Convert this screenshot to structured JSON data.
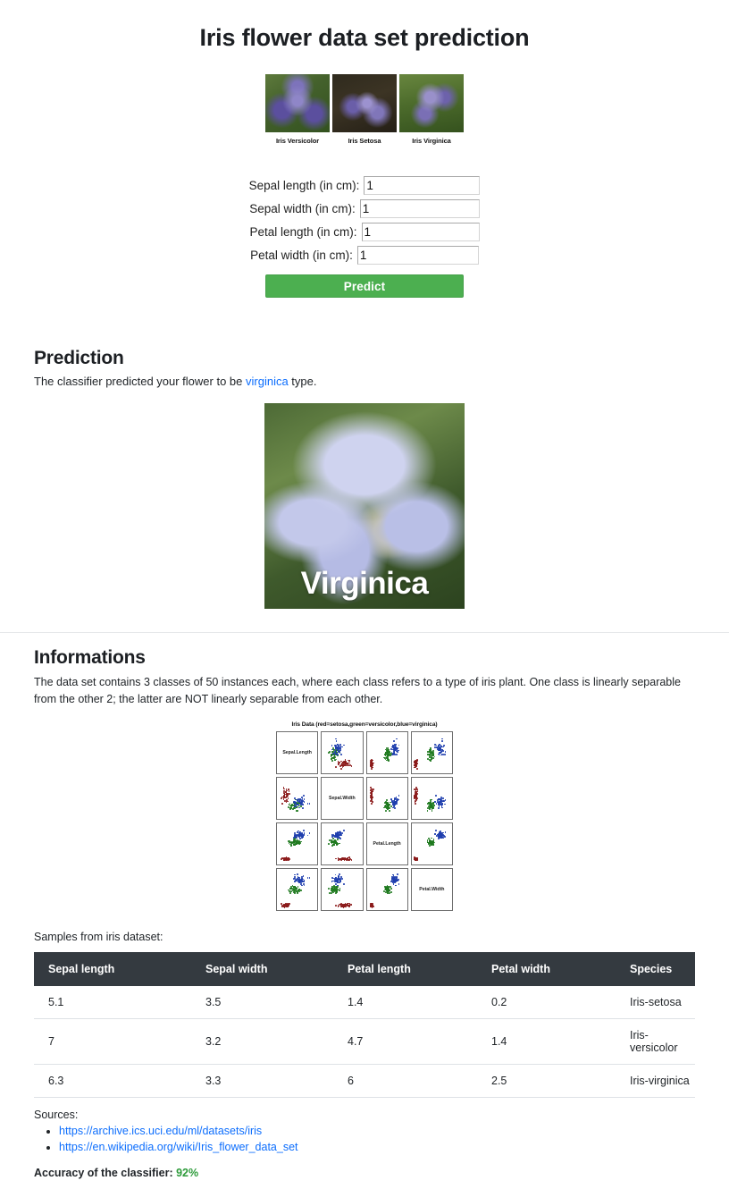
{
  "page": {
    "title": "Iris flower data set prediction"
  },
  "species_strip": {
    "items": [
      {
        "caption": "Iris Versicolor",
        "photo": "iris-versicolor-photo"
      },
      {
        "caption": "Iris Setosa",
        "photo": "iris-setosa-photo"
      },
      {
        "caption": "Iris Virginica",
        "photo": "iris-virginica-photo"
      }
    ]
  },
  "form": {
    "fields": [
      {
        "label": "Sepal length (in cm):",
        "value": "1",
        "name": "sepal-length"
      },
      {
        "label": "Sepal width (in cm):",
        "value": "1",
        "name": "sepal-width"
      },
      {
        "label": "Petal length (in cm):",
        "value": "1",
        "name": "petal-length"
      },
      {
        "label": "Petal width (in cm):",
        "value": "1",
        "name": "petal-width"
      }
    ],
    "submit_label": "Predict",
    "submit_color": "#4caf50"
  },
  "prediction": {
    "heading": "Prediction",
    "sentence_before": "The classifier predicted your flower to be ",
    "species_link": "virginica",
    "sentence_after": " type.",
    "link_color": "#0d6efd",
    "result_image_caption": "Virginica"
  },
  "informations": {
    "heading": "Informations",
    "paragraph": "The data set contains 3 classes of 50 instances each, where each class refers to a type of iris plant. One class is linearly separable from the other 2; the latter are NOT linearly separable from each other.",
    "samples_label": "Samples from iris dataset:"
  },
  "chart_data": {
    "type": "scatter",
    "title": "Iris Data (red=setosa,green=versicolor,blue=virginica)",
    "variables": [
      "Sepal.Length",
      "Sepal.Width",
      "Petal.Length",
      "Petal.Width"
    ],
    "legend": [
      {
        "label": "setosa",
        "color": "#8b1a1a"
      },
      {
        "label": "versicolor",
        "color": "#1f7a1f"
      },
      {
        "label": "virginica",
        "color": "#1f3fae"
      }
    ],
    "axis_ticks": {
      "Sepal.Length": [
        "4.5",
        "5.5",
        "6.5",
        "7.5"
      ],
      "Sepal.Width": [
        "2.0",
        "3.0",
        "4.0"
      ],
      "Petal.Length": [
        "1",
        "2",
        "3",
        "4",
        "5",
        "6",
        "7"
      ],
      "Petal.Width": [
        "0.5",
        "1.5",
        "2.5"
      ]
    },
    "grid": false,
    "legend_position": "title"
  },
  "table": {
    "columns": [
      "Sepal length",
      "Sepal width",
      "Petal length",
      "Petal width",
      "Species"
    ],
    "rows": [
      [
        "5.1",
        "3.5",
        "1.4",
        "0.2",
        "Iris-setosa"
      ],
      [
        "7",
        "3.2",
        "4.7",
        "1.4",
        "Iris-versicolor"
      ],
      [
        "6.3",
        "3.3",
        "6",
        "2.5",
        "Iris-virginica"
      ]
    ]
  },
  "sources": {
    "label": "Sources:",
    "links": [
      "https://archive.ics.uci.edu/ml/datasets/iris",
      "https://en.wikipedia.org/wiki/Iris_flower_data_set"
    ]
  },
  "accuracy": {
    "label": "Accuracy of the classifier:",
    "value": "92%",
    "color": "#2e9b3b"
  }
}
